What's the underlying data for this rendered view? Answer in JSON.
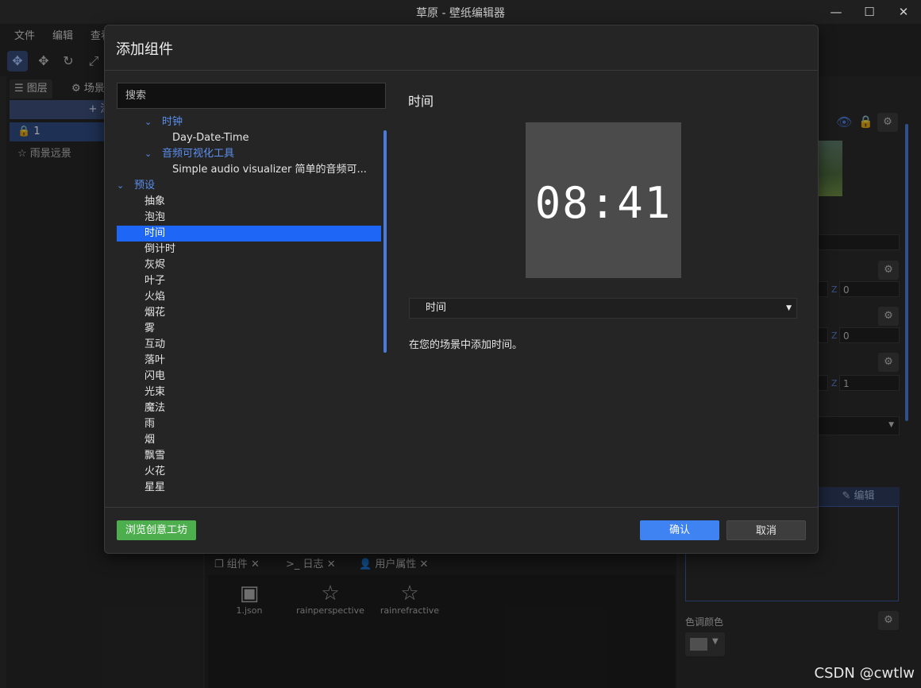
{
  "window": {
    "title": "草原 - 壁纸编辑器"
  },
  "menubar": {
    "items": [
      "文件",
      "编辑",
      "查看"
    ]
  },
  "left_panel": {
    "tabs": [
      "图层",
      "场景"
    ],
    "add_button": "添加",
    "layers": [
      "1",
      "雨景远景"
    ]
  },
  "bottom_panel": {
    "tabs": [
      "组件",
      "日志",
      "用户属性"
    ],
    "assets": [
      {
        "label": "1.json",
        "icon": "image-icon"
      },
      {
        "label": "rainperspective",
        "icon": "star-icon"
      },
      {
        "label": "rainrefractive",
        "icon": "star-icon"
      }
    ]
  },
  "right_panel": {
    "z_values": [
      "0",
      "0",
      "1"
    ],
    "edit_tab": "编辑",
    "tone_label": "色调颜色"
  },
  "dialog": {
    "title": "添加组件",
    "search_placeholder": "搜索",
    "tree": {
      "clock_group": "时钟",
      "clock_item": "Day-Date-Time",
      "audio_group": "音频可视化工具",
      "audio_item": "Simple audio visualizer 简单的音频可...",
      "presets_group": "预设",
      "presets": [
        "抽象",
        "泡泡",
        "时间",
        "倒计时",
        "灰烬",
        "叶子",
        "火焰",
        "烟花",
        "雾",
        "互动",
        "落叶",
        "闪电",
        "光束",
        "魔法",
        "雨",
        "烟",
        "飘雪",
        "火花",
        "星星"
      ],
      "selected": "时间"
    },
    "preview": {
      "title": "时间",
      "clock_display": "08:41",
      "variant": "时间",
      "description": "在您的场景中添加时间。"
    },
    "buttons": {
      "workshop": "浏览创意工坊",
      "confirm": "确认",
      "cancel": "取消"
    }
  },
  "watermark": "CSDN @cwtlw",
  "colors": {
    "accent": "#1e66f5",
    "confirm": "#3f82f1",
    "workshop": "#4cae4c",
    "background": "#252525"
  }
}
